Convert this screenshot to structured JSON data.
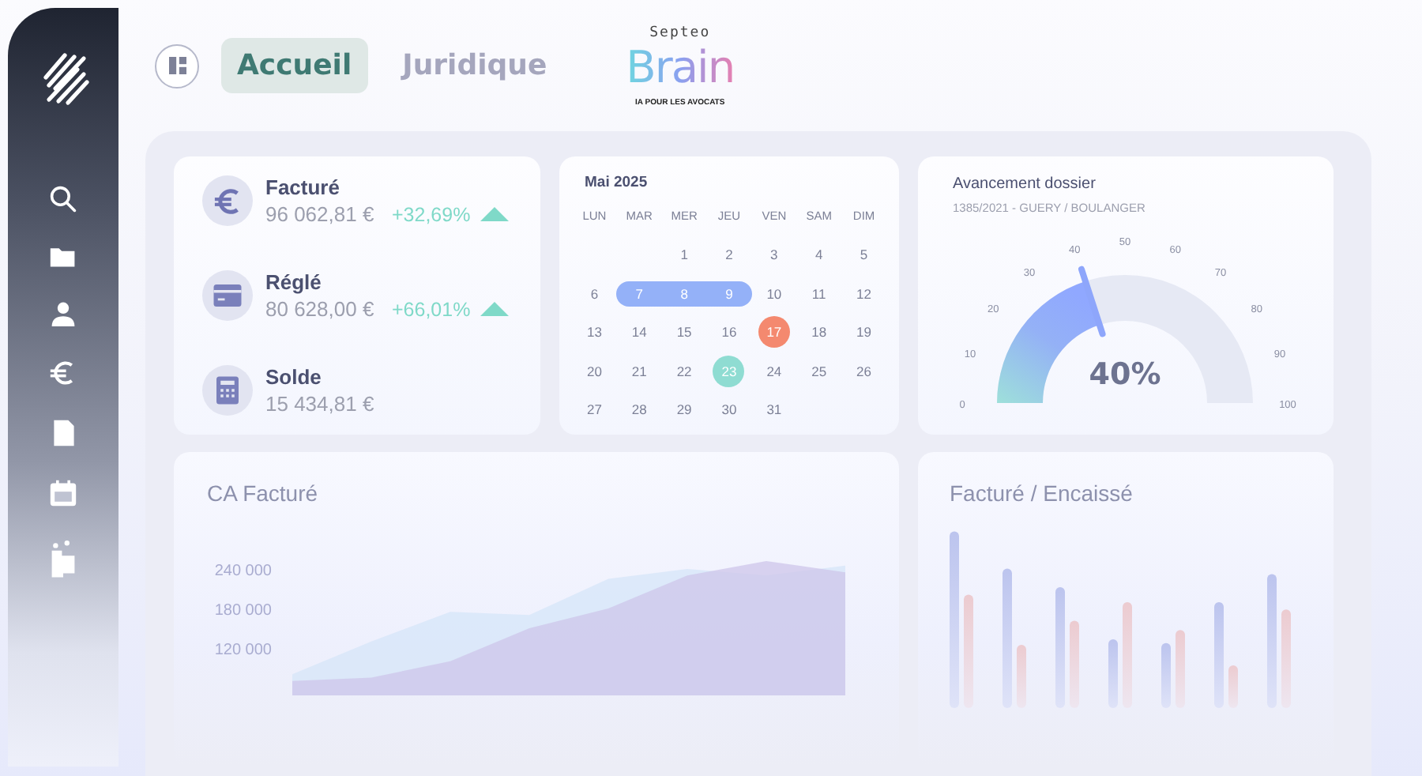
{
  "tabs": [
    {
      "label": "Accueil",
      "selected": true
    },
    {
      "label": "Juridique",
      "selected": false
    }
  ],
  "logo": {
    "top": "Septeo",
    "name": "Brain",
    "tagline": "IA POUR LES AVOCATS"
  },
  "stats": [
    {
      "label": "Facturé",
      "value": "96 062,81 €",
      "change": "+32,69%"
    },
    {
      "label": "Réglé",
      "value": "80 628,00 €",
      "change": "+66,01%"
    },
    {
      "label": "Solde",
      "value": "15 434,81 €"
    }
  ],
  "calendar": {
    "title": "Mai 2025",
    "weekdays": [
      "LUN",
      "MAR",
      "MER",
      "JEU",
      "VEN",
      "SAM",
      "DIM"
    ],
    "weeks": [
      [
        {
          "kind": "empty"
        },
        {
          "kind": "empty"
        },
        {
          "day": "1",
          "kind": "day"
        },
        {
          "day": "2",
          "kind": "day"
        },
        {
          "day": "3",
          "kind": "day"
        },
        {
          "day": "4",
          "kind": "day"
        },
        {
          "day": "5",
          "kind": "day"
        }
      ],
      [
        {
          "day": "6",
          "kind": "day"
        },
        {
          "day": "7",
          "kind": "range"
        },
        {
          "day": "8",
          "kind": "range"
        },
        {
          "day": "9",
          "kind": "range"
        },
        {
          "day": "10",
          "kind": "day"
        },
        {
          "day": "11",
          "kind": "day"
        },
        {
          "day": "12",
          "kind": "day"
        }
      ],
      [
        {
          "day": "13",
          "kind": "day"
        },
        {
          "day": "14",
          "kind": "day"
        },
        {
          "day": "15",
          "kind": "day"
        },
        {
          "day": "16",
          "kind": "day"
        },
        {
          "day": "17",
          "kind": "event",
          "color": "#f4896f"
        },
        {
          "day": "18",
          "kind": "day"
        },
        {
          "day": "19",
          "kind": "day"
        }
      ],
      [
        {
          "day": "20",
          "kind": "day"
        },
        {
          "day": "21",
          "kind": "day"
        },
        {
          "day": "22",
          "kind": "day"
        },
        {
          "day": "23",
          "kind": "event",
          "color": "#8fdcd2"
        },
        {
          "day": "24",
          "kind": "day"
        },
        {
          "day": "25",
          "kind": "day"
        },
        {
          "day": "26",
          "kind": "day"
        }
      ],
      [
        {
          "day": "27",
          "kind": "day"
        },
        {
          "day": "28",
          "kind": "day"
        },
        {
          "day": "29",
          "kind": "day"
        },
        {
          "day": "30",
          "kind": "day"
        },
        {
          "day": "31",
          "kind": "day"
        },
        {
          "kind": "empty"
        },
        {
          "kind": "empty"
        }
      ]
    ]
  },
  "gauge": {
    "title": "Avancement dossier",
    "subtitle": "1385/2021 - GUERY / BOULANGER",
    "level": 0.4,
    "reading": "40%",
    "ticks": [
      "0",
      "10",
      "20",
      "30",
      "40",
      "50",
      "60",
      "70",
      "80",
      "90",
      "100"
    ]
  },
  "revenue": {
    "title": "CA Facturé",
    "axis_labels": [
      "240 000",
      "180 000",
      "120 000"
    ]
  },
  "billing": {
    "title": "Facturé / Encaissé"
  }
}
